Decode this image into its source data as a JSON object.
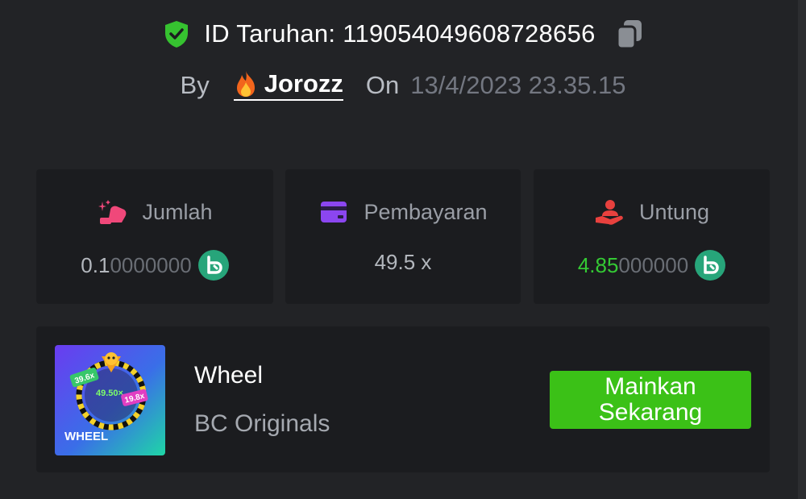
{
  "header": {
    "bet_id": "ID Taruhan: 119054049608728656",
    "by_label": "By",
    "username": "Jorozz",
    "on_label": "On",
    "date": "13/4/2023 23.35.15"
  },
  "stats": {
    "amount": {
      "label": "Jumlah",
      "value_main": "0.1",
      "value_zeros": "0000000",
      "icon": "money-hand-icon"
    },
    "payout": {
      "label": "Pembayaran",
      "value": "49.5 x",
      "icon": "card-icon"
    },
    "profit": {
      "label": "Untung",
      "value_main": "4.85",
      "value_zeros": "000000",
      "icon": "profit-hand-icon"
    }
  },
  "game": {
    "thumb_title": "WHEEL",
    "thumb_mult_center": "49.50×",
    "thumb_mult_left": "39.6x",
    "thumb_mult_right": "19.8x",
    "name": "Wheel",
    "provider": "BC Originals",
    "play_button": "Mainkan Sekarang"
  },
  "colors": {
    "background": "#222326",
    "card": "#1b1c1f",
    "accent_green": "#3bc117",
    "profit_green": "#34c934",
    "coin_green": "#27a57a"
  }
}
